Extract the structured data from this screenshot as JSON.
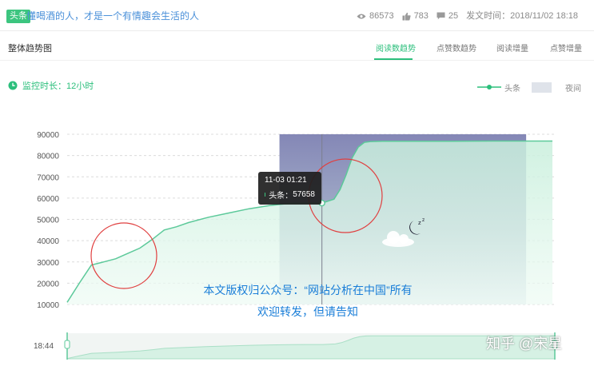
{
  "article": {
    "badge": "头条",
    "title": "懂喝酒的人，才是一个有情趣会生活的人",
    "views": "86573",
    "likes": "783",
    "comments": "25",
    "publish_time": "发文时间：2018/11/02 18:18"
  },
  "section": {
    "title": "整体趋势图",
    "tabs": [
      {
        "label": "阅读数趋势",
        "active": true
      },
      {
        "label": "点赞数趋势",
        "active": false
      },
      {
        "label": "阅读增量",
        "active": false
      },
      {
        "label": "点赞增量",
        "active": false
      }
    ]
  },
  "monitor": {
    "label": "监控时长：12小时"
  },
  "legend": {
    "series_label": "头条",
    "night_label": "夜间"
  },
  "tooltip": {
    "time": "11-03 01:21",
    "series": "头条：",
    "value": "57658"
  },
  "watermark": {
    "line1": "本文版权归公众号：“网站分析在中国”所有",
    "line2": "欢迎转发，但请告知"
  },
  "brand": "知乎 @宋星",
  "slider": {
    "start_label": "18:44"
  },
  "colors": {
    "accent": "#2cbf7c",
    "line": "#5cc99a",
    "night": "#8e90b8",
    "title_blue": "#4a90d9"
  },
  "chart_data": {
    "type": "area",
    "y_ticks": [
      "90000",
      "80000",
      "70000",
      "60000",
      "50000",
      "40000",
      "30000",
      "20000",
      "10000"
    ],
    "ylim": [
      10000,
      90000
    ],
    "x_range_hours": [
      0,
      12
    ],
    "x_unit": "hours since 11-02 18:44",
    "series": [
      {
        "name": "头条",
        "x": [
          0,
          0.3,
          0.6,
          0.9,
          1.2,
          1.5,
          1.8,
          2.1,
          2.4,
          2.7,
          3.0,
          3.5,
          4.0,
          4.5,
          5.0,
          5.5,
          6.0,
          6.3,
          6.6,
          6.75,
          6.9,
          7.05,
          7.2,
          7.35,
          7.5,
          7.8,
          8.5,
          9.5,
          10.5,
          11.5,
          12.0
        ],
        "values": [
          11000,
          20000,
          28500,
          30000,
          31500,
          34000,
          36500,
          40500,
          45000,
          46500,
          48500,
          51000,
          53000,
          55000,
          56500,
          57500,
          57600,
          57658,
          59500,
          64000,
          71000,
          79000,
          84000,
          86200,
          86600,
          86700,
          86700,
          86750,
          86800,
          86800,
          86800
        ]
      }
    ],
    "night_range_hours": [
      5.25,
      11.35
    ],
    "tooltip_hour": 6.3,
    "annotations": [
      "moon-and-cloud night marker"
    ]
  }
}
